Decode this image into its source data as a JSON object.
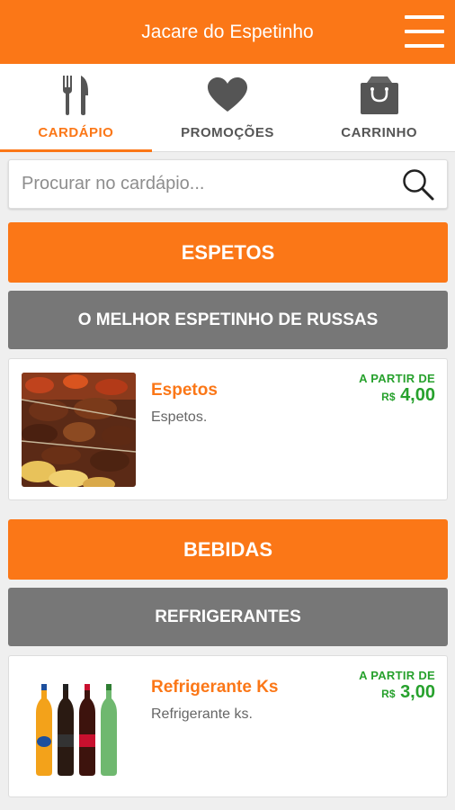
{
  "header": {
    "title": "Jacare do Espetinho",
    "menu_icon": "hamburger-menu-icon"
  },
  "tabs": [
    {
      "label": "CARDÁPIO",
      "icon": "fork-knife-icon",
      "active": true
    },
    {
      "label": "PROMOÇÕES",
      "icon": "heart-icon",
      "active": false
    },
    {
      "label": "CARRINHO",
      "icon": "shopping-bag-icon",
      "active": false
    }
  ],
  "search": {
    "placeholder": "Procurar no cardápio...",
    "icon": "search-icon"
  },
  "categories": [
    {
      "name": "ESPETOS",
      "subcategory": "O MELHOR ESPETINHO DE RUSSAS",
      "item": {
        "title": "Espetos",
        "description": "Espetos.",
        "price_prefix": "A PARTIR DE",
        "currency": "R$",
        "price": "4,00"
      }
    },
    {
      "name": "BEBIDAS",
      "subcategory": "REFRIGERANTES",
      "item": {
        "title": "Refrigerante Ks",
        "description": "Refrigerante ks.",
        "price_prefix": "A PARTIR DE",
        "currency": "R$",
        "price": "3,00"
      }
    }
  ],
  "colors": {
    "primary": "#fb7717",
    "subcategory": "#777777",
    "price": "#27a12d",
    "tab_inactive": "#555555"
  }
}
